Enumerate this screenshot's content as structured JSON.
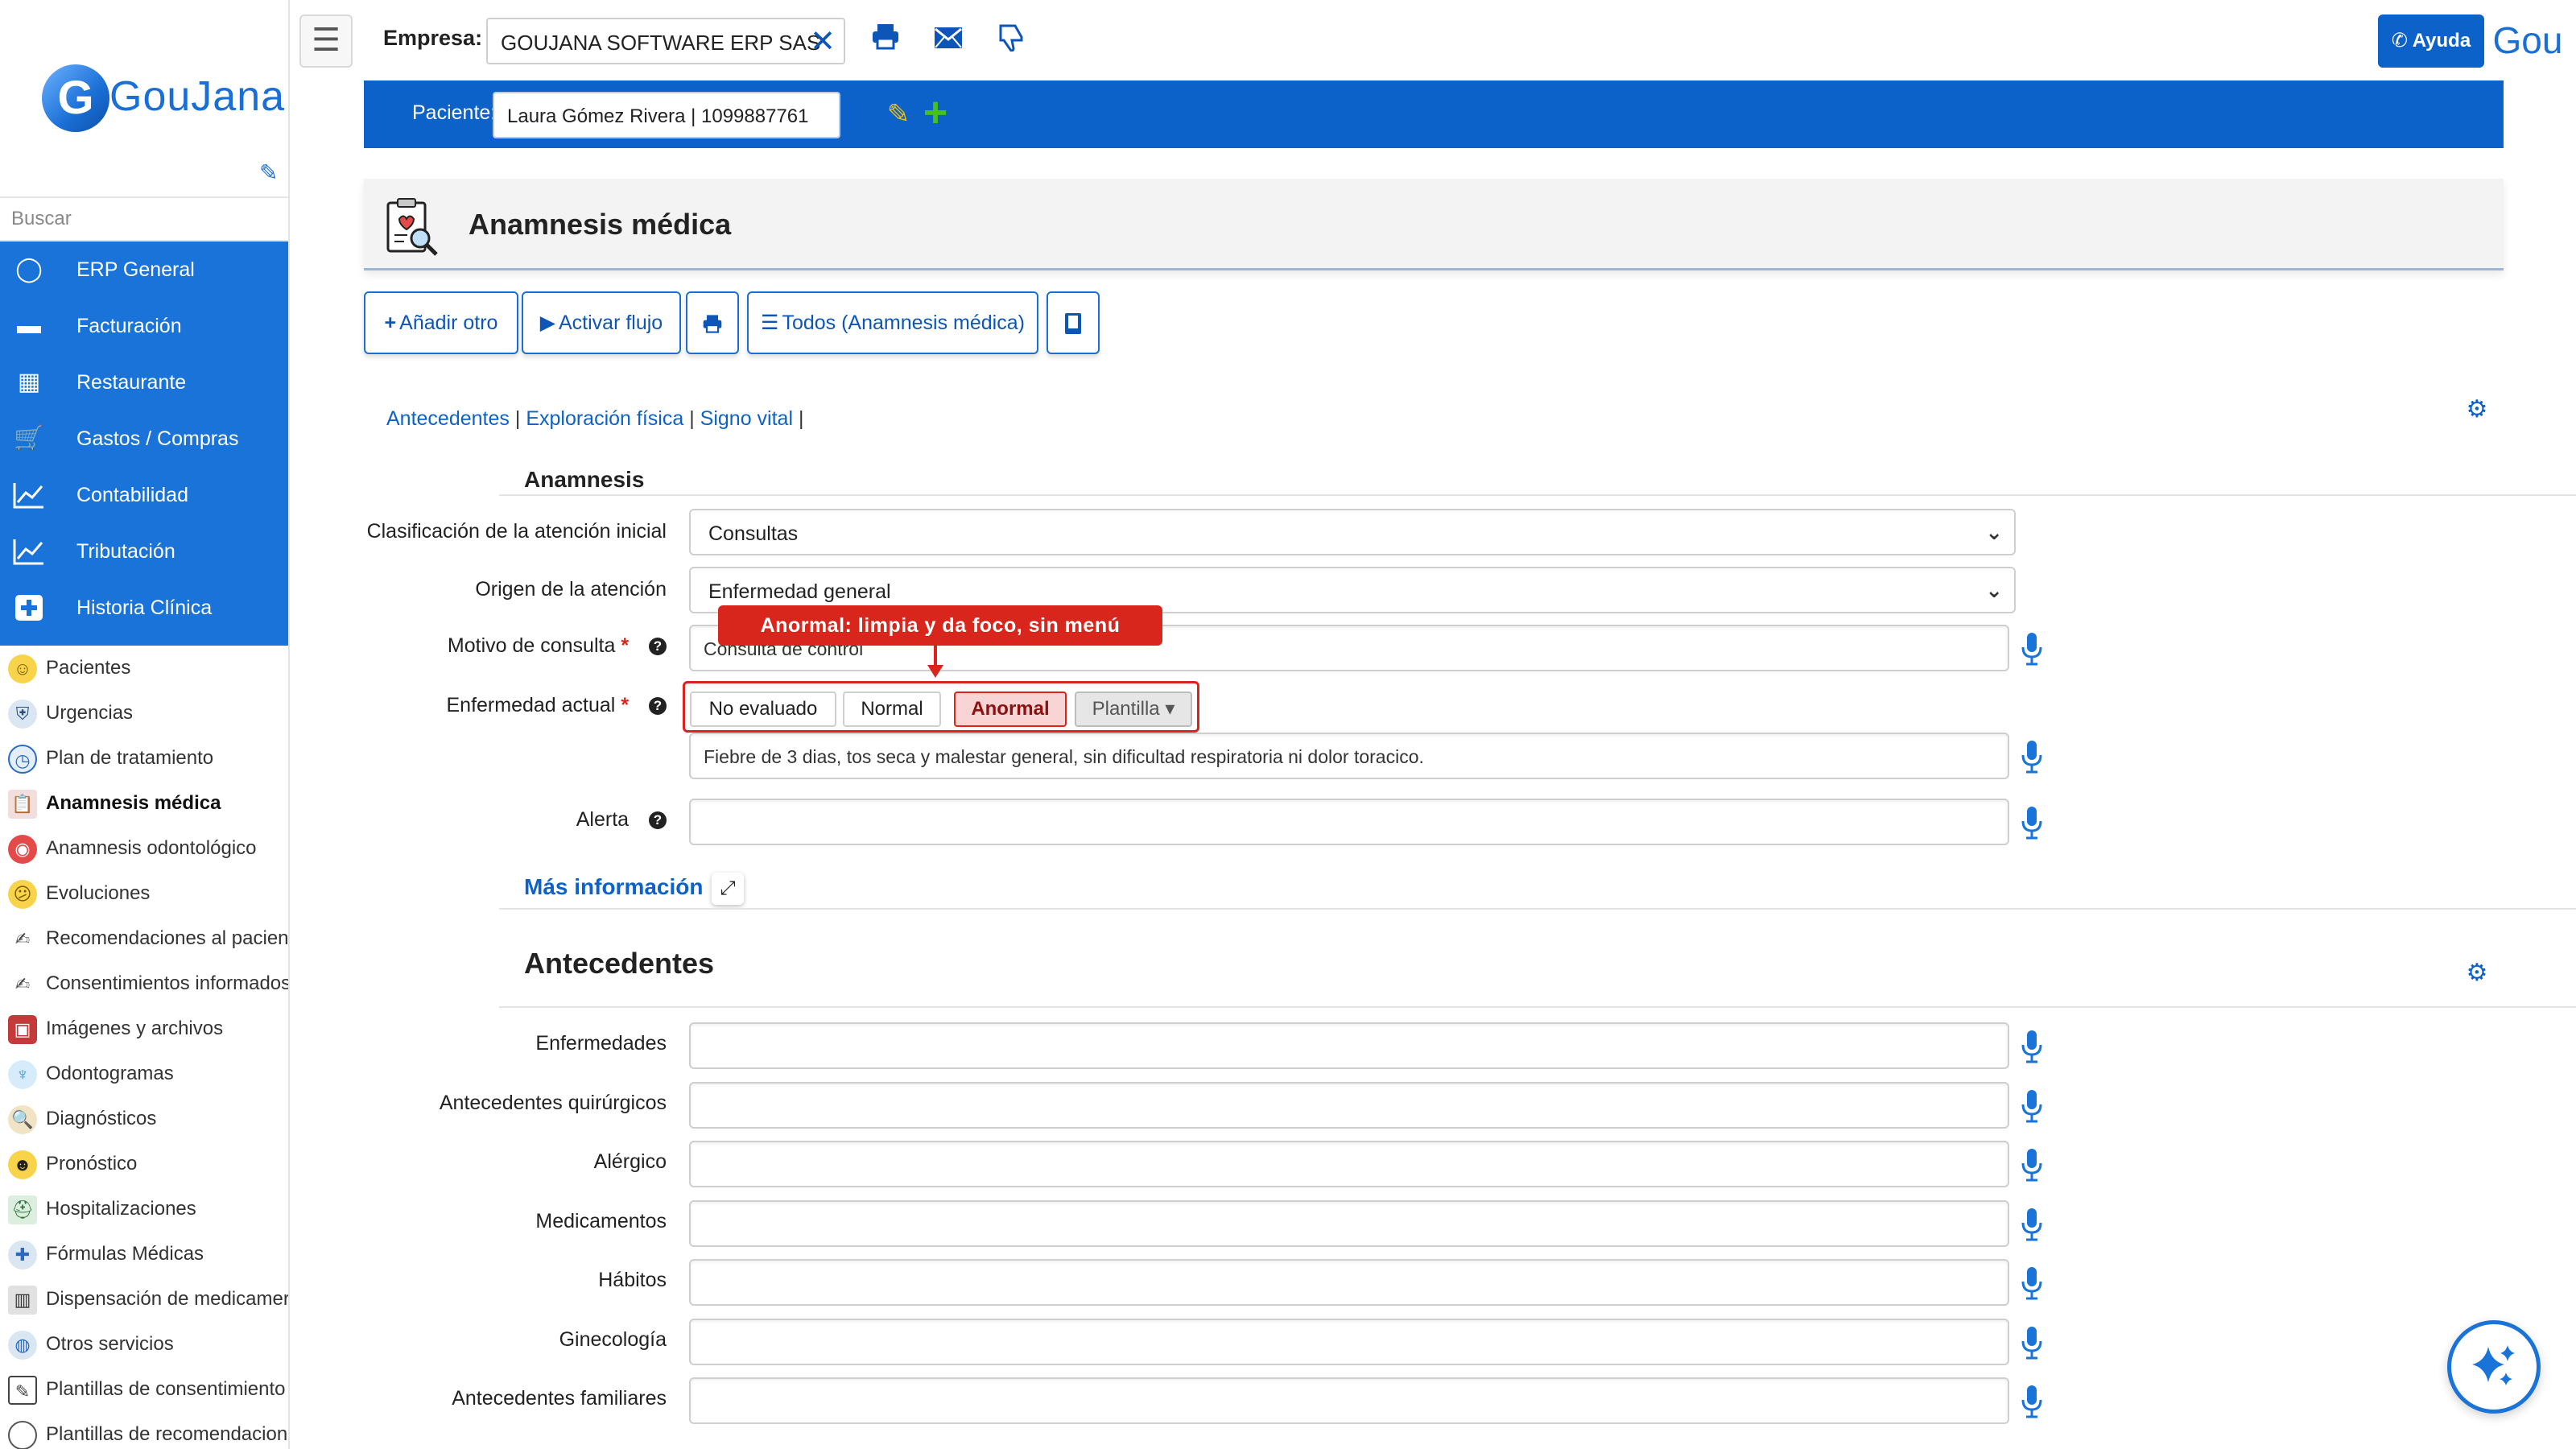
{
  "sidebar": {
    "logo_letter": "G",
    "logo_text": "GouJana",
    "search_placeholder": "Buscar",
    "blue_items": [
      {
        "label": "ERP General",
        "icon": "circle-notch-icon"
      },
      {
        "label": "Facturación",
        "icon": "credit-card-icon"
      },
      {
        "label": "Restaurante",
        "icon": "calendar-icon"
      },
      {
        "label": "Gastos / Compras",
        "icon": "cart-icon"
      },
      {
        "label": "Contabilidad",
        "icon": "line-chart-icon"
      },
      {
        "label": "Tributación",
        "icon": "line-chart-icon"
      },
      {
        "label": "Historia Clínica",
        "icon": "plus-square-icon"
      }
    ],
    "items": [
      {
        "label": "Pacientes",
        "icon": "smiley-icon",
        "color": "#f2c200"
      },
      {
        "label": "Urgencias",
        "icon": "ambulance-shield-icon",
        "color": "#5b7fa8"
      },
      {
        "label": "Plan de tratamiento",
        "icon": "stopwatch-icon",
        "color": "#3a7fd0"
      },
      {
        "label": "Anamnesis médica",
        "icon": "clipboard-icon",
        "color": "#c43a3a"
      },
      {
        "label": "Anamnesis odontológico",
        "icon": "mouth-icon",
        "color": "#d9261c"
      },
      {
        "label": "Evoluciones",
        "icon": "thinking-face-icon",
        "color": "#f2c200"
      },
      {
        "label": "Recomendaciones al pacien",
        "icon": "signature-icon",
        "color": "#555555"
      },
      {
        "label": "Consentimientos informados",
        "icon": "signature-icon",
        "color": "#555555"
      },
      {
        "label": "Imágenes y archivos",
        "icon": "camera-icon",
        "color": "#c43a3a"
      },
      {
        "label": "Odontogramas",
        "icon": "tooth-icon",
        "color": "#6fb6e8"
      },
      {
        "label": "Diagnósticos",
        "icon": "magnifier-icon",
        "color": "#c9a14a"
      },
      {
        "label": "Pronóstico",
        "icon": "person-icon",
        "color": "#333333"
      },
      {
        "label": "Hospitalizaciones",
        "icon": "hospital-bed-icon",
        "color": "#4a8f5a"
      },
      {
        "label": "Fórmulas Médicas",
        "icon": "medical-shield-icon",
        "color": "#3a7fd0"
      },
      {
        "label": "Dispensación de medicamer",
        "icon": "building-icon",
        "color": "#555555"
      },
      {
        "label": "Otros servicios",
        "icon": "globe-icon",
        "color": "#3a7fd0"
      },
      {
        "label": "Plantillas de consentimiento",
        "icon": "document-pen-icon",
        "color": "#555555"
      },
      {
        "label": "Plantillas de recomendacion",
        "icon": "circle-outline-icon",
        "color": "#555555"
      }
    ]
  },
  "topbar": {
    "empresa_label": "Empresa:",
    "empresa_value": "GOUJANA SOFTWARE ERP SAS",
    "ayuda_label": "Ayuda",
    "avatar_text": "Gou"
  },
  "patient": {
    "label": "Paciente:",
    "value": "Laura Gómez Rivera | 1099887761"
  },
  "page": {
    "title": "Anamnesis médica"
  },
  "actions": {
    "add_label": "Añadir otro",
    "flow_label": "Activar flujo",
    "all_label": "Todos (Anamnesis médica)"
  },
  "links": {
    "antecedentes": "Antecedentes",
    "exploracion": "Exploración física",
    "signo": "Signo vital",
    "sep": "|"
  },
  "anamnesis": {
    "section_title": "Anamnesis",
    "clasificacion_label": "Clasificación de la atención inicial",
    "clasificacion_value": "Consultas",
    "origen_label": "Origen de la atención",
    "origen_value": "Enfermedad general",
    "motivo_label": "Motivo de consulta",
    "motivo_value": "Consulta de control",
    "enfermedad_label": "Enfermedad actual",
    "required_mark": "*",
    "state_buttons": [
      "No evaluado",
      "Normal",
      "Anormal",
      "Plantilla ▾"
    ],
    "enfermedad_value": "Fiebre de 3 dias, tos seca y malestar general, sin dificultad respiratoria ni dolor toracico.",
    "alerta_label": "Alerta",
    "alerta_value": "",
    "mas_info": "Más información"
  },
  "tooltip": {
    "text": "Anormal: limpia y da foco, sin menú"
  },
  "antecedentes": {
    "section_title": "Antecedentes",
    "fields": [
      {
        "label": "Enfermedades",
        "value": ""
      },
      {
        "label": "Antecedentes quirúrgicos",
        "value": ""
      },
      {
        "label": "Alérgico",
        "value": ""
      },
      {
        "label": "Medicamentos",
        "value": ""
      },
      {
        "label": "Hábitos",
        "value": ""
      },
      {
        "label": "Ginecología",
        "value": ""
      },
      {
        "label": "Antecedentes familiares",
        "value": ""
      }
    ]
  },
  "colors": {
    "primary": "#0d62c9",
    "sidebar_blue": "#1a73d9",
    "alert_red": "#d9261c",
    "anormal_bg": "#f9d4d4"
  }
}
